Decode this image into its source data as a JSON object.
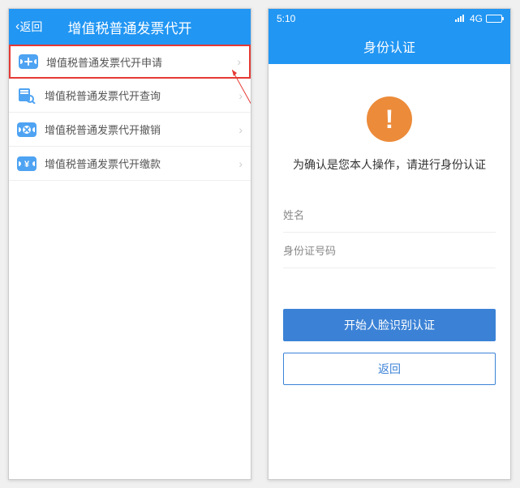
{
  "phone1": {
    "back_label": "返回",
    "title": "增值税普通发票代开",
    "items": [
      {
        "label": "增值税普通发票代开申请",
        "highlighted": true
      },
      {
        "label": "增值税普通发票代开查询",
        "highlighted": false
      },
      {
        "label": "增值税普通发票代开撤销",
        "highlighted": false
      },
      {
        "label": "增值税普通发票代开缴款",
        "highlighted": false
      }
    ]
  },
  "phone2": {
    "status_time": "5:10",
    "status_network": "4G",
    "title": "身份认证",
    "message": "为确认是您本人操作，请进行身份认证",
    "field_name": "姓名",
    "field_id": "身份证号码",
    "btn_primary": "开始人脸识别认证",
    "btn_secondary": "返回"
  }
}
